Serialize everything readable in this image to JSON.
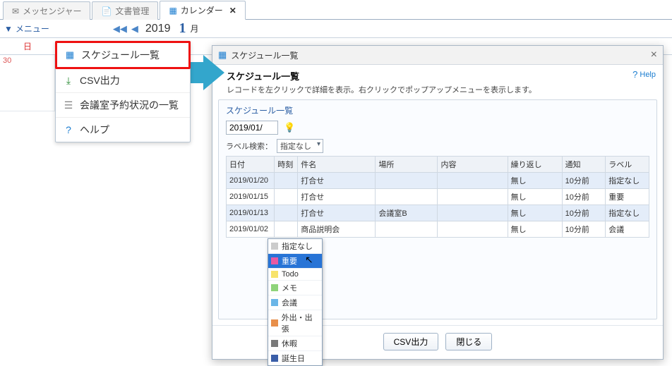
{
  "tabs": {
    "messenger": {
      "label": "メッセンジャー"
    },
    "docs": {
      "label": "文書管理"
    },
    "calendar": {
      "label": "カレンダー"
    }
  },
  "topbar": {
    "menu_label": "メニュー",
    "year": "2019",
    "month_num": "1",
    "month_suffix": "月"
  },
  "calendar": {
    "sunday_head": "日",
    "day30": "30"
  },
  "menu_popup": {
    "schedule_list": "スケジュール一覧",
    "csv_export": "CSV出力",
    "room_status": "会議室予約状況の一覧",
    "help": "ヘルプ"
  },
  "dialog": {
    "titlebar": "スケジュール一覧",
    "heading": "スケジュール一覧",
    "desc": "レコードを左クリックで詳細を表示。右クリックでポップアップメニューを表示します。",
    "help": "Help",
    "panel_label": "スケジュール一覧",
    "date_input": "2019/01/",
    "label_search_label": "ラベル検索：",
    "label_search_value": "指定なし",
    "columns": {
      "date": "日付",
      "time": "時刻",
      "subject": "件名",
      "place": "場所",
      "content": "内容",
      "repeat": "繰り返し",
      "notify": "通知",
      "label": "ラベル"
    },
    "rows": [
      {
        "date": "2019/01/20",
        "time": "",
        "subject": "打合せ",
        "place": "",
        "content": "",
        "repeat": "無し",
        "notify": "10分前",
        "label": "指定なし"
      },
      {
        "date": "2019/01/15",
        "time": "",
        "subject": "打合せ",
        "place": "",
        "content": "",
        "repeat": "無し",
        "notify": "10分前",
        "label": "重要"
      },
      {
        "date": "2019/01/13",
        "time": "",
        "subject": "打合せ",
        "place": "会議室B",
        "content": "",
        "repeat": "無し",
        "notify": "10分前",
        "label": "指定なし"
      },
      {
        "date": "2019/01/02",
        "time": "",
        "subject": "商品説明会",
        "place": "",
        "content": "",
        "repeat": "無し",
        "notify": "10分前",
        "label": "会議"
      }
    ],
    "label_options": [
      {
        "name": "指定なし",
        "color": "#cccccc"
      },
      {
        "name": "重要",
        "color": "#e85aa3"
      },
      {
        "name": "Todo",
        "color": "#f7e36a"
      },
      {
        "name": "メモ",
        "color": "#8fd47a"
      },
      {
        "name": "会議",
        "color": "#6bb6e7"
      },
      {
        "name": "外出・出張",
        "color": "#e88f4a"
      },
      {
        "name": "休暇",
        "color": "#7a7a7a"
      },
      {
        "name": "誕生日",
        "color": "#3a5ea8"
      }
    ],
    "btn_csv": "CSV出力",
    "btn_close": "閉じる"
  }
}
